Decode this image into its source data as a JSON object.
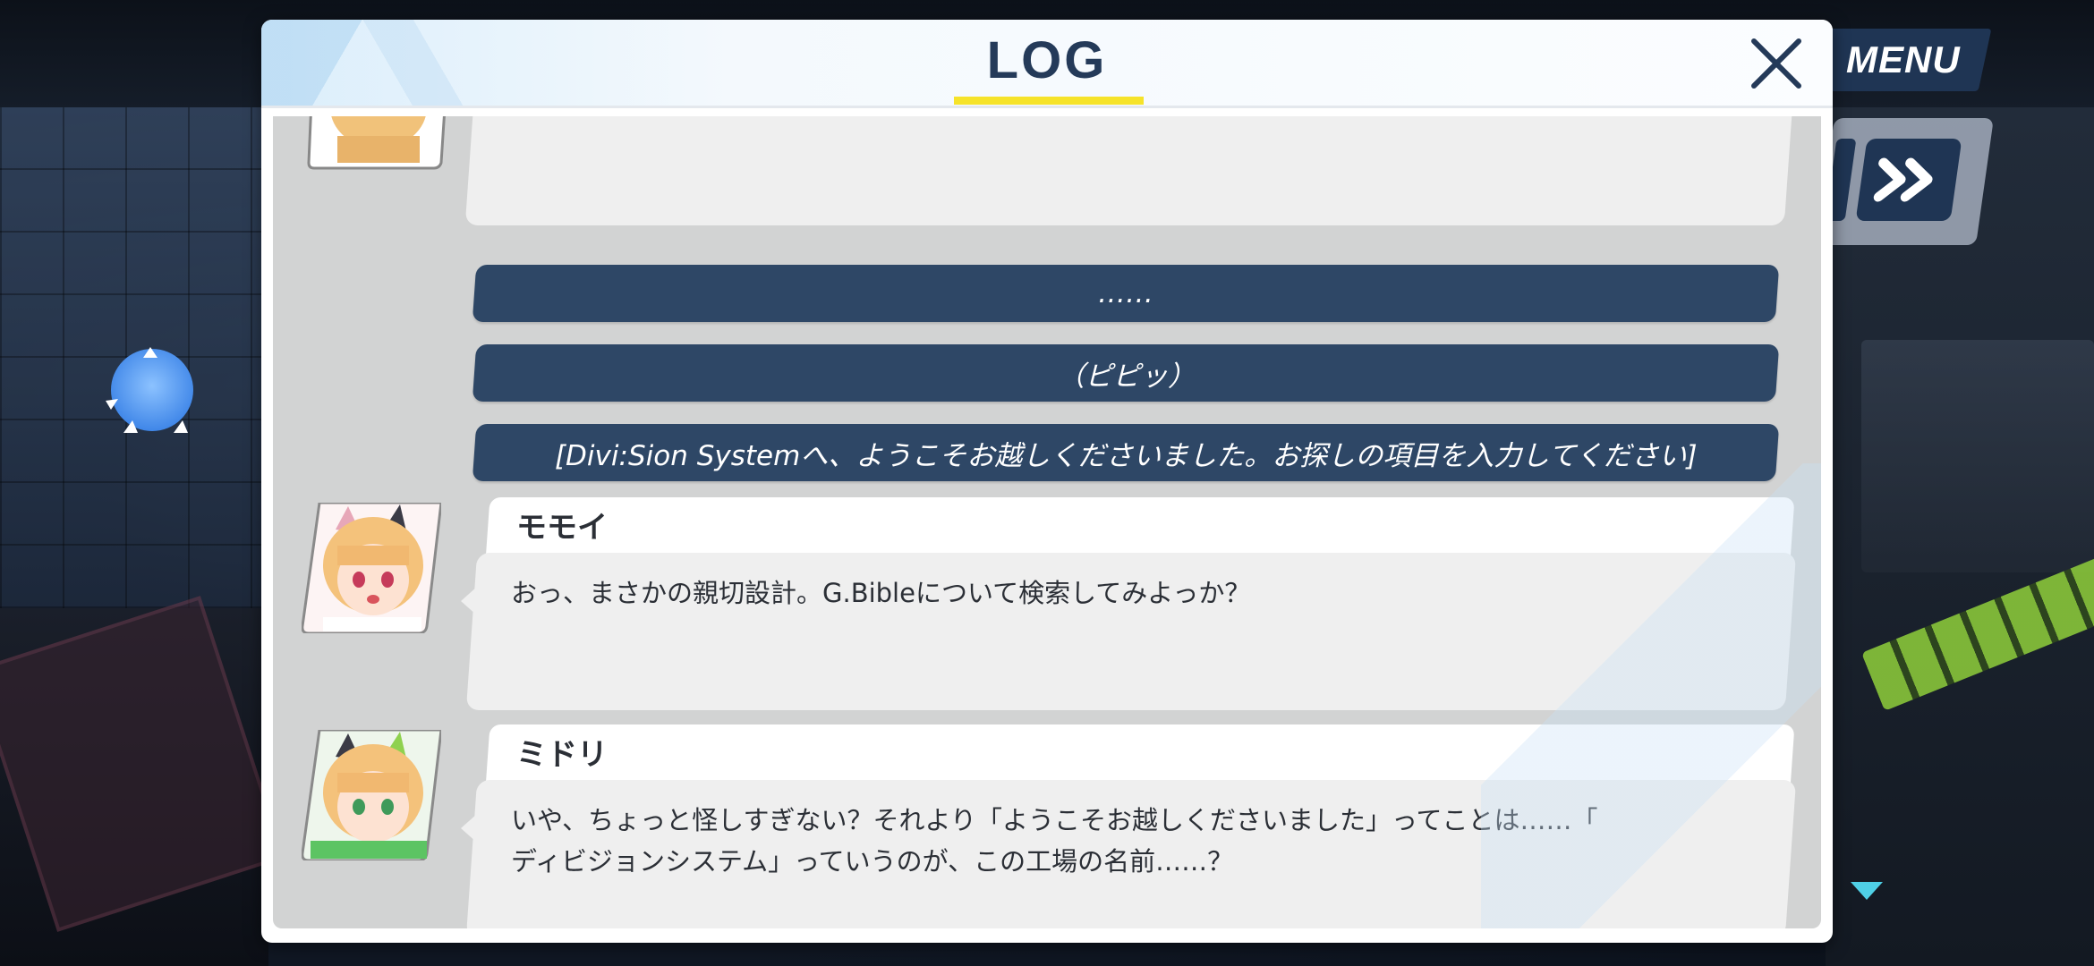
{
  "hud": {
    "menu_label": "MENU",
    "skip_icon": "double-chevron-right-icon"
  },
  "log": {
    "title": "LOG",
    "close_icon": "close-icon",
    "accent_color": "#f6e32a",
    "title_color": "#243a59",
    "narration_bg": "#2e4766",
    "narrations": [
      "……",
      "（ピピッ）",
      "[Divi:Sion Systemへ、ようこそお越しくださいました。お探しの項目を入力してください]"
    ],
    "entries": [
      {
        "speaker": "モモイ",
        "text": "おっ、まさかの親切設計。G.Bibleについて検索してみよっか？",
        "avatar": "momoi-avatar"
      },
      {
        "speaker": "ミドリ",
        "text": "いや、ちょっと怪しすぎない？それより「ようこそお越しくださいました」ってことは……「\nディビジョンシステム」っていうのが、この工場の名前……？",
        "avatar": "midori-avatar"
      }
    ]
  }
}
